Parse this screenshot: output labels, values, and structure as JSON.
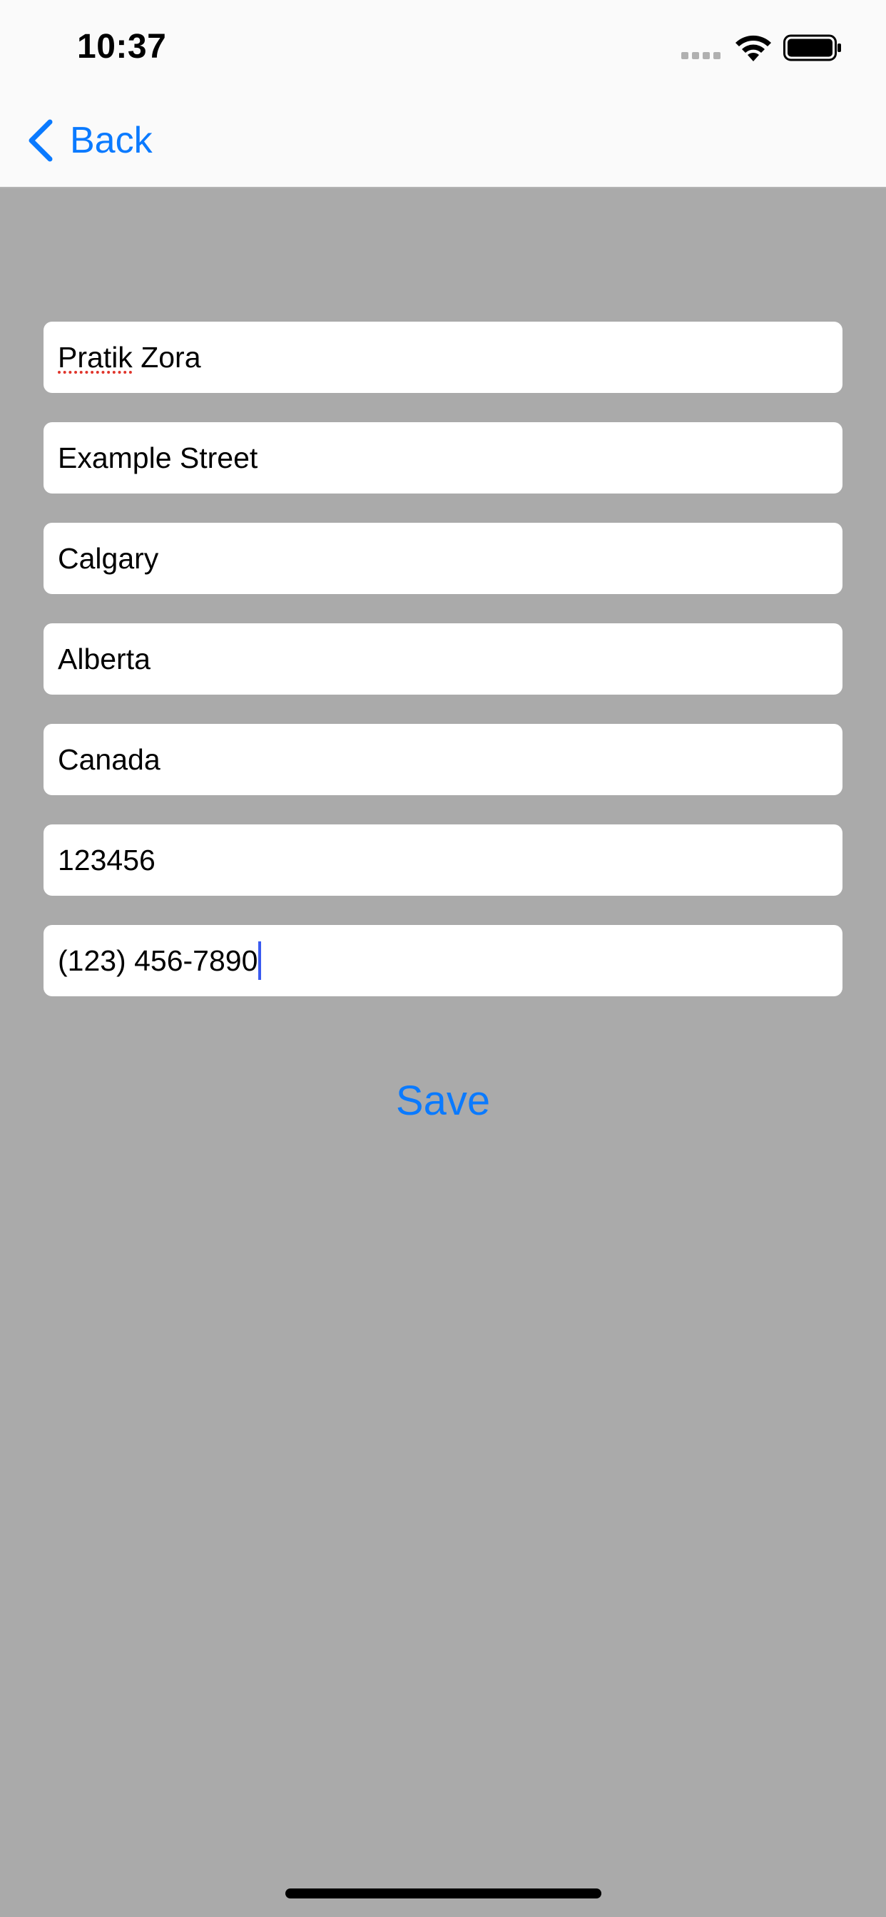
{
  "status_bar": {
    "time": "10:37"
  },
  "nav": {
    "back_label": "Back"
  },
  "form": {
    "fields": [
      {
        "value": "Pratik Zora",
        "misspelled_word": "Pratik",
        "rest": " Zora"
      },
      {
        "value": "Example Street"
      },
      {
        "value": "Calgary"
      },
      {
        "value": "Alberta"
      },
      {
        "value": "Canada"
      },
      {
        "value": "123456"
      },
      {
        "value": "(123) 456-7890"
      }
    ],
    "save_label": "Save"
  },
  "colors": {
    "accent": "#0a7aff",
    "background": "#aaaaaa",
    "nav_background": "#fafafa",
    "field_background": "#ffffff",
    "caret": "#3a5bf0",
    "spellcheck": "#e0352b"
  }
}
